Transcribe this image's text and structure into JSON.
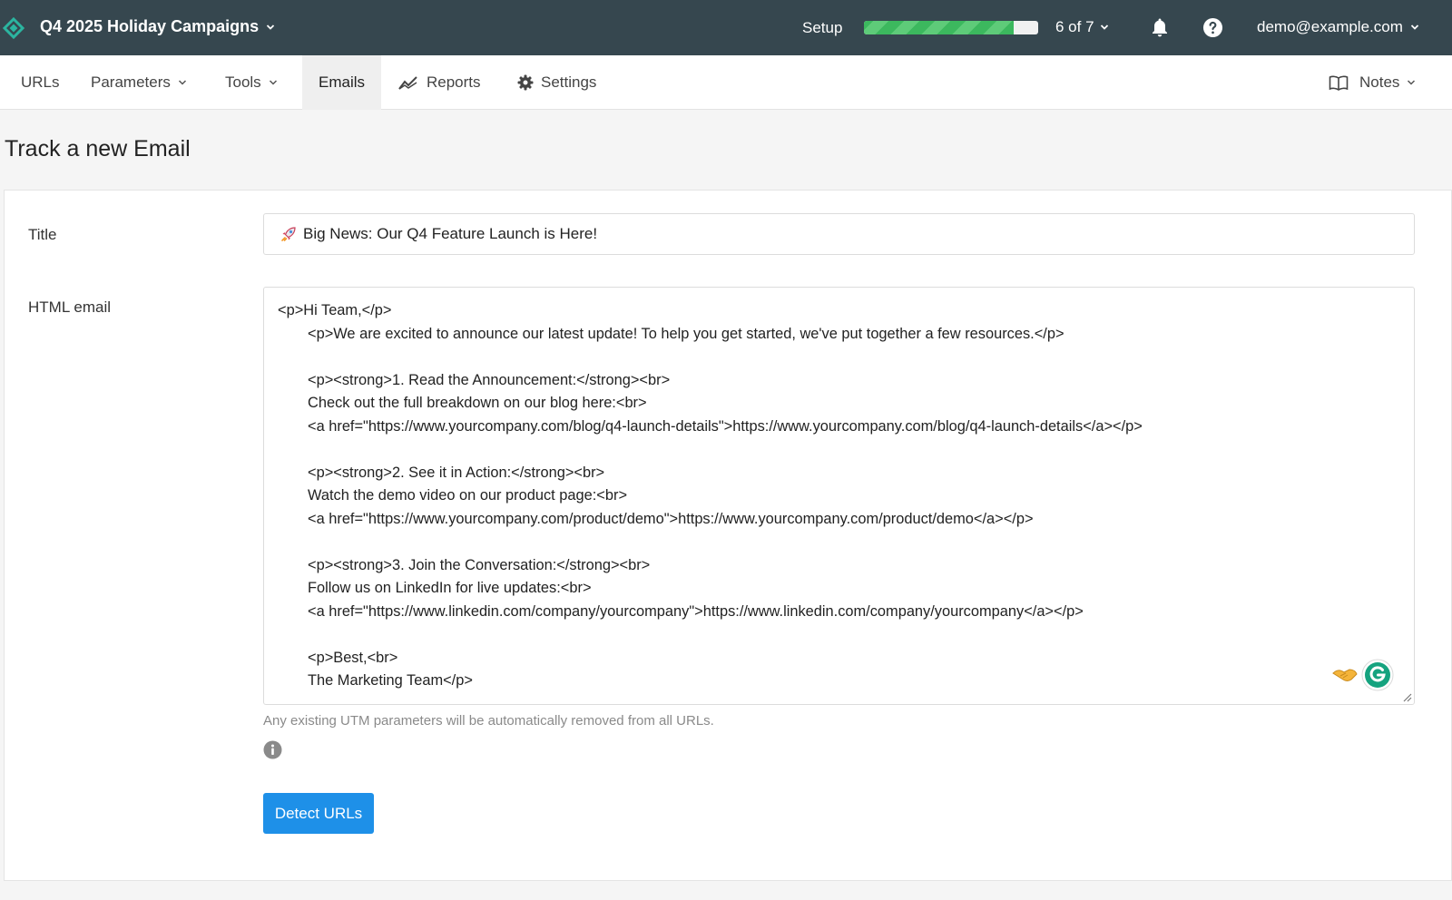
{
  "header": {
    "project_name": "Q4 2025 Holiday Campaigns",
    "setup_label": "Setup",
    "setup_progress": {
      "completed": 6,
      "total": 7,
      "text": "6 of 7"
    },
    "account_email": "demo@example.com"
  },
  "nav": {
    "urls": "URLs",
    "parameters": "Parameters",
    "tools": "Tools",
    "emails": "Emails",
    "reports": "Reports",
    "settings": "Settings",
    "notes": "Notes",
    "active": "Emails"
  },
  "page": {
    "title": "Track a new Email"
  },
  "form": {
    "title_label": "Title",
    "title_value": "Big News: Our Q4 Feature Launch is Here!",
    "title_emoji": "rocket-icon",
    "html_label": "HTML email",
    "html_lines": [
      "<p>Hi Team,</p>",
      "<p>We are excited to announce our latest update! To help you get started, we've put together a few resources.</p>",
      "",
      "<p><strong>1. Read the Announcement:</strong><br>",
      "Check out the full breakdown on our blog here:<br>",
      "<a href=\"https://www.yourcompany.com/blog/q4-launch-details\">https://www.yourcompany.com/blog/q4-launch-details</a></p>",
      "",
      "<p><strong>2. See it in Action:</strong><br>",
      "Watch the demo video on our product page:<br>",
      "<a href=\"https://www.yourcompany.com/product/demo\">https://www.yourcompany.com/product/demo</a></p>",
      "",
      "<p><strong>3. Join the Conversation:</strong><br>",
      "Follow us on LinkedIn for live updates:<br>",
      "<a href=\"https://www.linkedin.com/company/yourcompany\">https://www.linkedin.com/company/yourcompany</a></p>",
      "",
      "<p>Best,<br>",
      "The Marketing Team</p>"
    ],
    "hint": "Any existing UTM parameters will be automatically removed from all URLs.",
    "detect_button": "Detect URLs"
  },
  "colors": {
    "topbar": "#36474f",
    "progress_green": "#3cb85e",
    "primary_button": "#1e90e8",
    "logo": "#2bb5a0"
  }
}
